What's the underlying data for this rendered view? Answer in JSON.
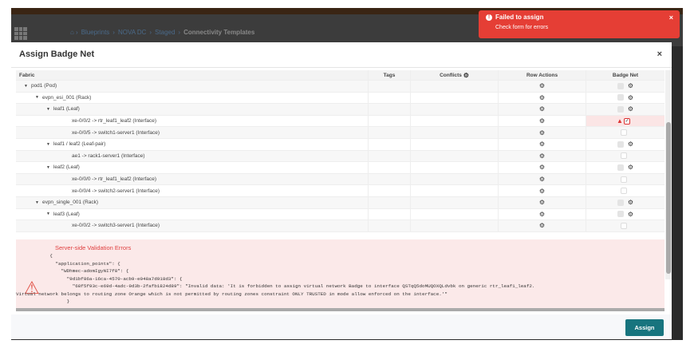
{
  "breadcrumb": [
    "Blueprints",
    "NOVA DC",
    "Staged",
    "Connectivity Templates"
  ],
  "toast": {
    "title": "Failed to assign",
    "message": "Check form for errors",
    "close": "×"
  },
  "modal": {
    "title": "Assign Badge Net",
    "close": "×",
    "assign_label": "Assign"
  },
  "table": {
    "headers": {
      "fabric": "Fabric",
      "tags": "Tags",
      "conflicts": "Conflicts",
      "row_actions": "Row Actions",
      "badge_net": "Badge Net"
    },
    "rows": [
      {
        "label": "pod1 (Pod)",
        "level": 1,
        "caret": true,
        "badge": "disabled-gear"
      },
      {
        "label": "evpn_esi_001 (Rack)",
        "level": 2,
        "caret": true,
        "badge": "disabled-gear"
      },
      {
        "label": "leaf1 (Leaf)",
        "level": 3,
        "caret": true,
        "badge": "disabled-gear"
      },
      {
        "label": "xe-0/0/2 -> rtr_leaf1_leaf2 (Interface)",
        "level": 4,
        "caret": false,
        "badge": "error-checked"
      },
      {
        "label": "xe-0/0/5 -> switch1-server1 (Interface)",
        "level": 4,
        "caret": false,
        "badge": "empty"
      },
      {
        "label": "leaf1 / leaf2 (Leaf-pair)",
        "level": 3,
        "caret": true,
        "badge": "disabled-gear"
      },
      {
        "label": "ae1 -> rack1-server1 (Interface)",
        "level": 4,
        "caret": false,
        "badge": "empty"
      },
      {
        "label": "leaf2 (Leaf)",
        "level": 3,
        "caret": true,
        "badge": "disabled-gear"
      },
      {
        "label": "xe-0/0/0 -> rtr_leaf1_leaf2 (Interface)",
        "level": 4,
        "caret": false,
        "badge": "empty"
      },
      {
        "label": "xe-0/0/4 -> switch2-server1 (Interface)",
        "level": 4,
        "caret": false,
        "badge": "empty"
      },
      {
        "label": "evpn_single_001 (Rack)",
        "level": 2,
        "caret": true,
        "badge": "disabled-gear"
      },
      {
        "label": "leaf3 (Leaf)",
        "level": 3,
        "caret": true,
        "badge": "disabled-gear"
      },
      {
        "label": "xe-0/0/2 -> switch3-server1 (Interface)",
        "level": 4,
        "caret": false,
        "badge": "empty"
      }
    ]
  },
  "errors": {
    "title": "Server-side Validation Errors",
    "body": "            {\n              \"application_points\": {\n                \"WDhmec-adomIgyNI7f8\": {\n                  \"9d1bf86a-16ca-4570-acb9-e048a7d918d3\": {\n                    \"68f5f93c-e69d-4adc-9d3b-2fafb1824d89\": \"Invalid data: 'It is forbidden to assign virtual network Badge to interface QSTqQ5doMUQOXQLdvbk on generic rtr_leaf1_leaf2.\nVirtual network belongs to routing zone Orange which is not permitted by routing zones constraint ONLY TRUSTED in mode allow enforced on the interface.'\"\n                  }"
  }
}
